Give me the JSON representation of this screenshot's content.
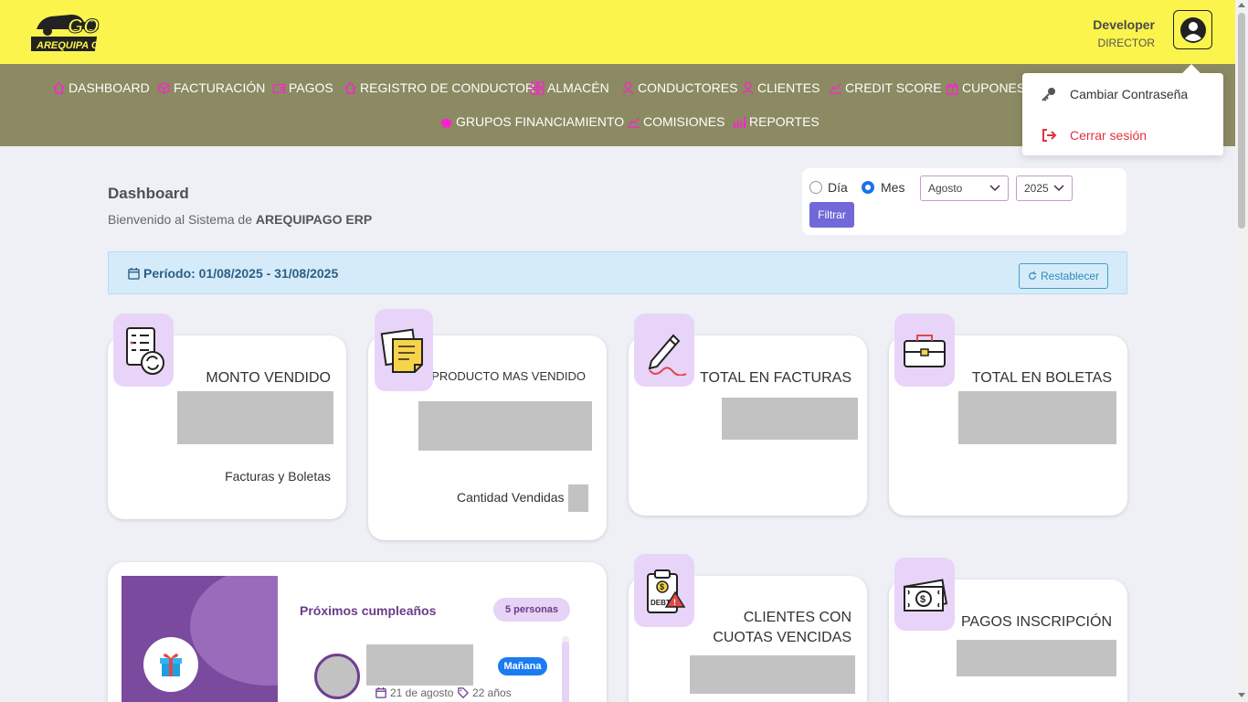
{
  "header": {
    "logo_text": "AREQUIPA GO",
    "logo_mark": "GO",
    "user_name": "Developer",
    "user_role": "DIRECTOR"
  },
  "nav": {
    "items": [
      {
        "label": "DASHBOARD",
        "icon": "home-icon"
      },
      {
        "label": "FACTURACIÓN",
        "icon": "box-icon"
      },
      {
        "label": "PAGOS",
        "icon": "wallet-icon"
      },
      {
        "label": "REGISTRO DE CONDUCTOR",
        "icon": "home-icon"
      },
      {
        "label": "ALMACÉN",
        "icon": "grid-icon"
      },
      {
        "label": "CONDUCTORES",
        "icon": "user-icon"
      },
      {
        "label": "CLIENTES",
        "icon": "user-icon"
      },
      {
        "label": "CREDIT SCORE",
        "icon": "chart-line-icon"
      },
      {
        "label": "CUPONES",
        "icon": "gift-icon"
      },
      {
        "label": "GRUPOS FINANCIAMIENTO",
        "icon": "piggy-bank-icon"
      },
      {
        "label": "COMISIONES",
        "icon": "chart-line-icon"
      },
      {
        "label": "REPORTES",
        "icon": "bar-chart-icon"
      }
    ]
  },
  "dropdown": {
    "change_password": "Cambiar Contraseña",
    "logout": "Cerrar sesión"
  },
  "page": {
    "title": "Dashboard",
    "welcome_prefix": "Bienvenido al Sistema de",
    "welcome_brand": "AREQUIPAGO ERP"
  },
  "filter": {
    "day_label": "Día",
    "month_label": "Mes",
    "selected_mode": "Mes",
    "month_value": "Agosto",
    "year_value": "2025",
    "filter_button": "Filtrar"
  },
  "period": {
    "text": "Período: 01/08/2025 - 31/08/2025",
    "reset_button": "Restablecer"
  },
  "cards": {
    "monto_vendido": {
      "title": "MONTO VENDIDO",
      "subtitle": "Facturas y Boletas"
    },
    "producto": {
      "title": "PRODUCTO MAS VENDIDO",
      "subtitle": "Cantidad Vendidas"
    },
    "facturas": {
      "title": "TOTAL EN FACTURAS"
    },
    "boletas": {
      "title": "TOTAL EN BOLETAS"
    },
    "cuotas": {
      "title_line1": "CLIENTES CON",
      "title_line2": "CUOTAS VENCIDAS"
    },
    "inscripcion": {
      "title": "PAGOS INSCRIPCIÓN"
    }
  },
  "birthdays": {
    "title": "Próximos cumpleaños",
    "count_badge": "5 personas",
    "first": {
      "tag": "Mañana",
      "date": "21 de agosto",
      "age": "22 años"
    }
  },
  "colors": {
    "topbar": "#fbf44d",
    "navbar": "#8c8a62",
    "nav_icon": "#ff1fd2",
    "accent_purple": "#7168d9",
    "icon_bg": "#e8d4f8"
  }
}
